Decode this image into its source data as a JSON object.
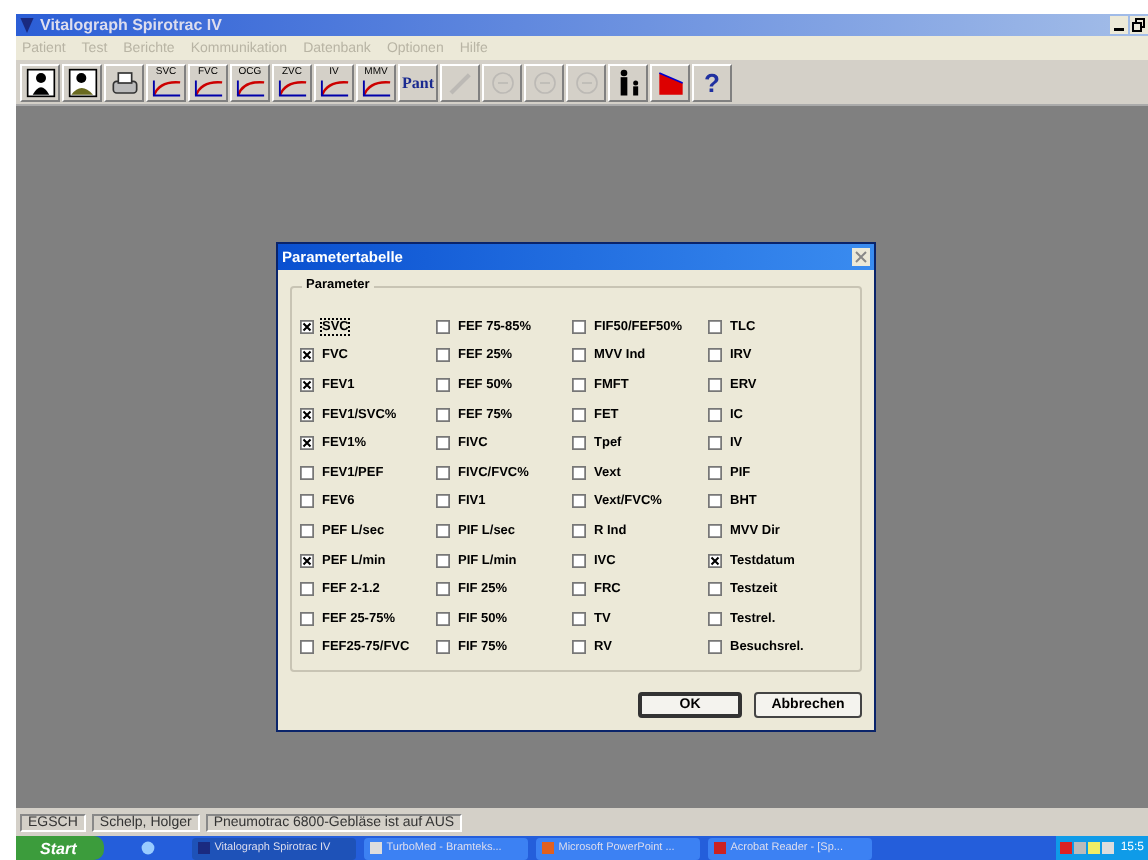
{
  "window": {
    "title": "Vitalograph Spirotrac IV"
  },
  "menu": [
    "Patient",
    "Test",
    "Berichte",
    "Kommunikation",
    "Datenbank",
    "Optionen",
    "Hilfe"
  ],
  "toolbar": [
    {
      "kind": "person",
      "disabled": false
    },
    {
      "kind": "patient",
      "disabled": false
    },
    {
      "kind": "printer",
      "disabled": false
    },
    {
      "kind": "test",
      "label": "SVC",
      "disabled": false
    },
    {
      "kind": "test",
      "label": "FVC",
      "disabled": false
    },
    {
      "kind": "test",
      "label": "OCG",
      "disabled": false
    },
    {
      "kind": "test",
      "label": "ZVC",
      "disabled": false
    },
    {
      "kind": "test",
      "label": "IV",
      "disabled": false
    },
    {
      "kind": "test",
      "label": "MMV",
      "disabled": false
    },
    {
      "kind": "text",
      "label": "Pant",
      "disabled": false
    },
    {
      "kind": "wand",
      "disabled": true
    },
    {
      "kind": "dial",
      "disabled": true
    },
    {
      "kind": "dial",
      "disabled": true
    },
    {
      "kind": "dial",
      "disabled": true
    },
    {
      "kind": "people",
      "disabled": false
    },
    {
      "kind": "chart",
      "disabled": false
    },
    {
      "kind": "help",
      "label": "?",
      "disabled": false
    }
  ],
  "dialog": {
    "title": "Parametertabelle",
    "group": "Parameter",
    "columns": [
      [
        {
          "label": "SVC",
          "checked": true
        },
        {
          "label": "FVC",
          "checked": true
        },
        {
          "label": "FEV1",
          "checked": true
        },
        {
          "label": "FEV1/SVC%",
          "checked": true
        },
        {
          "label": "FEV1%",
          "checked": true
        },
        {
          "label": "FEV1/PEF",
          "checked": false
        },
        {
          "label": "FEV6",
          "checked": false
        },
        {
          "label": "PEF L/sec",
          "checked": false
        },
        {
          "label": "PEF L/min",
          "checked": true
        },
        {
          "label": "FEF 2-1.2",
          "checked": false
        },
        {
          "label": "FEF 25-75%",
          "checked": false
        },
        {
          "label": "FEF25-75/FVC",
          "checked": false
        }
      ],
      [
        {
          "label": "FEF 75-85%",
          "checked": false
        },
        {
          "label": "FEF 25%",
          "checked": false
        },
        {
          "label": "FEF 50%",
          "checked": false
        },
        {
          "label": "FEF 75%",
          "checked": false
        },
        {
          "label": "FIVC",
          "checked": false
        },
        {
          "label": "FIVC/FVC%",
          "checked": false
        },
        {
          "label": "FIV1",
          "checked": false
        },
        {
          "label": "PIF L/sec",
          "checked": false
        },
        {
          "label": "PIF L/min",
          "checked": false
        },
        {
          "label": "FIF 25%",
          "checked": false
        },
        {
          "label": "FIF 50%",
          "checked": false
        },
        {
          "label": "FIF 75%",
          "checked": false
        }
      ],
      [
        {
          "label": "FIF50/FEF50%",
          "checked": false
        },
        {
          "label": "MVV Ind",
          "checked": false
        },
        {
          "label": "FMFT",
          "checked": false
        },
        {
          "label": "FET",
          "checked": false
        },
        {
          "label": "Tpef",
          "checked": false
        },
        {
          "label": "Vext",
          "checked": false
        },
        {
          "label": "Vext/FVC%",
          "checked": false
        },
        {
          "label": "R Ind",
          "checked": false
        },
        {
          "label": "IVC",
          "checked": false
        },
        {
          "label": "FRC",
          "checked": false
        },
        {
          "label": "TV",
          "checked": false
        },
        {
          "label": "RV",
          "checked": false
        }
      ],
      [
        {
          "label": "TLC",
          "checked": false
        },
        {
          "label": "IRV",
          "checked": false
        },
        {
          "label": "ERV",
          "checked": false
        },
        {
          "label": "IC",
          "checked": false
        },
        {
          "label": "IV",
          "checked": false
        },
        {
          "label": "PIF",
          "checked": false
        },
        {
          "label": "BHT",
          "checked": false
        },
        {
          "label": "MVV Dir",
          "checked": false
        },
        {
          "label": "Testdatum",
          "checked": true
        },
        {
          "label": "Testzeit",
          "checked": false
        },
        {
          "label": "Testrel.",
          "checked": false
        },
        {
          "label": "Besuchsrel.",
          "checked": false
        }
      ]
    ],
    "buttons": [
      {
        "label": "OK",
        "kind": "default"
      },
      {
        "label": "Abbrechen",
        "kind": "normal"
      }
    ]
  },
  "status_bar": [
    "EGSCH",
    "Schelp, Holger",
    "Pneumotrac 6800-Gebläse ist auf AUS"
  ],
  "taskbar": {
    "start": "Start",
    "tasks": [
      {
        "label": "Vitalograph Spirotrac IV",
        "selected": true,
        "kind": "app"
      },
      {
        "label": "TurboMed - Bramteks...",
        "selected": false,
        "kind": "folder"
      },
      {
        "label": "Microsoft PowerPoint ...",
        "selected": false,
        "kind": "ppt"
      },
      {
        "label": "Acrobat Reader - [Sp...",
        "selected": false,
        "kind": "pdf"
      }
    ],
    "clock": "15:5"
  }
}
